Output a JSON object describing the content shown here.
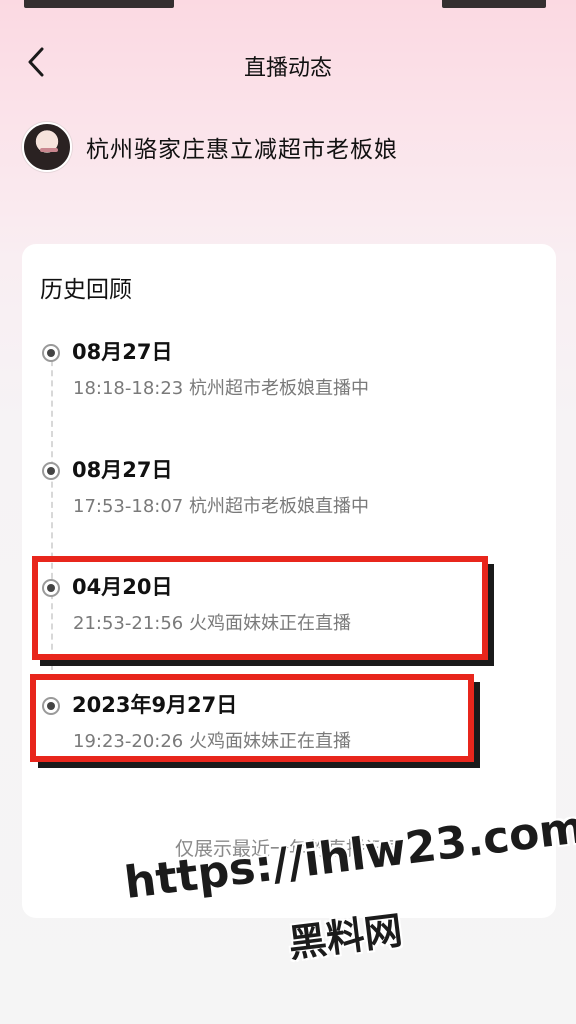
{
  "header": {
    "title": "直播动态",
    "back_icon": "chevron-left-icon"
  },
  "profile": {
    "name": "杭州骆家庄惠立减超市老板娘"
  },
  "history": {
    "title": "历史回顾",
    "entries": [
      {
        "date": "08月27日",
        "detail": "18:18-18:23 杭州超市老板娘直播中"
      },
      {
        "date": "08月27日",
        "detail": "17:53-18:07 杭州超市老板娘直播中"
      },
      {
        "date": "04月20日",
        "detail": "21:53-21:56 火鸡面妹妹正在直播"
      },
      {
        "date": "2023年9月27日",
        "detail": "19:23-20:26 火鸡面妹妹正在直播"
      }
    ],
    "footer_note": "仅展示最近一年的直播记录"
  },
  "watermark": {
    "url": "https://ihlw23.com",
    "site_name": "黑料网"
  },
  "colors": {
    "highlight": "#e8261c",
    "background_top": "#fbd9e2"
  }
}
